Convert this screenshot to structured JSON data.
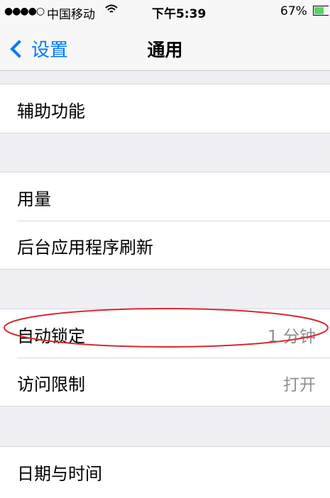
{
  "status_bar": {
    "signal": "●●●●○",
    "carrier": "中国移动",
    "wifi_icon": "wifi-icon",
    "time": "下午5:39",
    "battery_percent": "67%",
    "battery_level": 0.67,
    "battery_color": "#4cd964"
  },
  "nav": {
    "back_label": "设置",
    "title": "通用",
    "accent": "#007aff"
  },
  "groups": {
    "g1": {
      "rows": [
        {
          "label": "辅助功能"
        }
      ]
    },
    "g2": {
      "rows": [
        {
          "label": "用量"
        },
        {
          "label": "后台应用程序刷新"
        }
      ]
    },
    "g3": {
      "rows": [
        {
          "label": "自动锁定",
          "value": "1 分钟"
        },
        {
          "label": "访问限制",
          "value": "打开"
        }
      ]
    },
    "g4": {
      "rows": [
        {
          "label": "日期与时间"
        }
      ]
    }
  },
  "annotation": {
    "color": "#d9282f"
  }
}
